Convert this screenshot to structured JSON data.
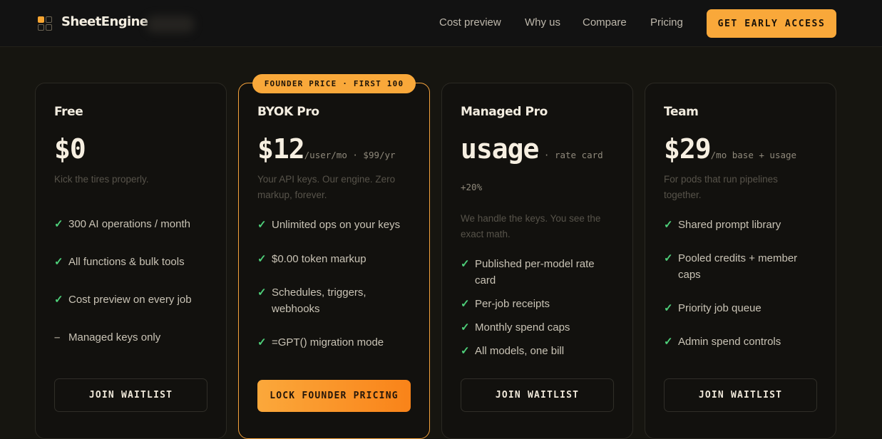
{
  "brand": {
    "name": "SheetEngine"
  },
  "nav": {
    "links": [
      "Cost preview",
      "Why us",
      "Compare",
      "Pricing"
    ],
    "cta": "GET EARLY ACCESS"
  },
  "colors": {
    "accent": "#f9a83a",
    "check": "#4ed07a",
    "background": "#161510"
  },
  "plans": [
    {
      "name": "Free",
      "price": "$0",
      "suffix": "",
      "description": "Kick the tires properly.",
      "features": [
        {
          "icon": "check",
          "text": "300 AI operations / month"
        },
        {
          "icon": "check",
          "text": "All functions & bulk tools"
        },
        {
          "icon": "check",
          "text": "Cost preview on every job"
        },
        {
          "icon": "dash",
          "text": "Managed keys only"
        }
      ],
      "button": "JOIN WAITLIST"
    },
    {
      "name": "BYOK Pro",
      "badge": "FOUNDER PRICE · FIRST 100",
      "price": "$12",
      "suffix": "/user/mo · $99/yr",
      "description": "Your API keys. Our engine. Zero markup, forever.",
      "features": [
        {
          "icon": "check",
          "text": "Unlimited ops on your keys"
        },
        {
          "icon": "check",
          "text": "$0.00 token markup"
        },
        {
          "icon": "check",
          "text": "Schedules, triggers, webhooks"
        },
        {
          "icon": "check",
          "text": "=GPT() migration mode"
        }
      ],
      "button": "LOCK FOUNDER PRICING"
    },
    {
      "name": "Managed Pro",
      "price": "usage",
      "suffix": " · rate card +20%",
      "description": "We handle the keys. You see the exact math.",
      "features": [
        {
          "icon": "check",
          "text": "Published per-model rate card"
        },
        {
          "icon": "check",
          "text": "Per-job receipts"
        },
        {
          "icon": "check",
          "text": "Monthly spend caps"
        },
        {
          "icon": "check",
          "text": "All models, one bill"
        }
      ],
      "button": "JOIN WAITLIST"
    },
    {
      "name": "Team",
      "price": "$29",
      "suffix": "/mo base + usage",
      "description": "For pods that run pipelines together.",
      "features": [
        {
          "icon": "check",
          "text": "Shared prompt library"
        },
        {
          "icon": "check",
          "text": "Pooled credits + member caps"
        },
        {
          "icon": "check",
          "text": "Priority job queue"
        },
        {
          "icon": "check",
          "text": "Admin spend controls"
        }
      ],
      "button": "JOIN WAITLIST"
    }
  ]
}
